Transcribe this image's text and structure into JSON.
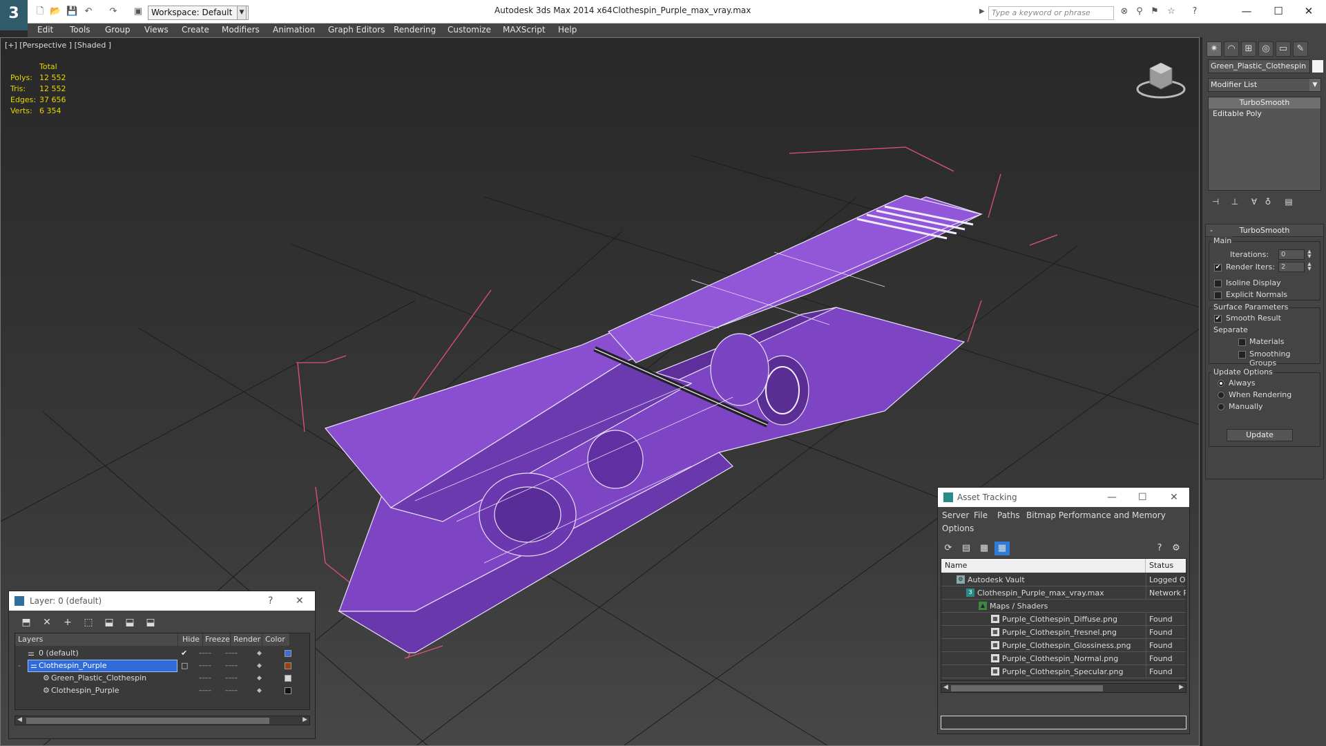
{
  "titlebar": {
    "workspace": "Workspace: Default",
    "app_title": "Autodesk 3ds Max  2014 x64",
    "file_title": "Clothespin_Purple_max_vray.max",
    "search_placeholder": "Type a keyword or phrase"
  },
  "menu": [
    "Edit",
    "Tools",
    "Group",
    "Views",
    "Create",
    "Modifiers",
    "Animation",
    "Graph Editors",
    "Rendering",
    "Customize",
    "MAXScript",
    "Help"
  ],
  "viewport": {
    "label": "[+] [Perspective ] [Shaded ]",
    "stats": {
      "header": "Total",
      "rows": [
        {
          "label": "Polys:",
          "value": "12 552"
        },
        {
          "label": "Tris:",
          "value": "12 552"
        },
        {
          "label": "Edges:",
          "value": "37 656"
        },
        {
          "label": "Verts:",
          "value": "6 354"
        }
      ]
    },
    "model_color": "#8a4fd1"
  },
  "command_panel": {
    "object_name": "Green_Plastic_Clothespin",
    "modifier_list": "Modifier List",
    "stack": [
      "TurboSmooth",
      "Editable Poly"
    ],
    "turbosmooth": {
      "title": "TurboSmooth",
      "main": "Main",
      "iterations_label": "Iterations:",
      "iterations": "0",
      "render_iters_label": "Render Iters:",
      "render_iters": "2",
      "isoline": "Isoline Display",
      "explicit_normals": "Explicit Normals",
      "surface_params": "Surface Parameters",
      "smooth_result": "Smooth Result",
      "separate": "Separate",
      "materials": "Materials",
      "smoothing_groups": "Smoothing Groups",
      "update_options": "Update Options",
      "always": "Always",
      "when_rendering": "When Rendering",
      "manually": "Manually",
      "update_button": "Update"
    }
  },
  "layer_window": {
    "title": "Layer: 0 (default)",
    "help": "?",
    "columns": [
      "Layers",
      "Hide",
      "Freeze",
      "Render",
      "Color"
    ],
    "rows": [
      {
        "name": "0 (default)",
        "color": "#3b6fd6"
      },
      {
        "name": "Clothespin_Purple",
        "color": "#9a3f10"
      },
      {
        "name": "Green_Plastic_Clothespin",
        "color": "#d8d8d8"
      },
      {
        "name": "Clothespin_Purple",
        "color": "#111111"
      }
    ]
  },
  "asset_window": {
    "title": "Asset Tracking",
    "menu": [
      "Server",
      "File",
      "Paths",
      "Bitmap Performance and Memory",
      "Options"
    ],
    "columns": [
      "Name",
      "Status"
    ],
    "rows": [
      {
        "name": "Autodesk Vault",
        "status": "Logged Ou"
      },
      {
        "name": "Clothespin_Purple_max_vray.max",
        "status": "Network Pa"
      },
      {
        "name": "Maps / Shaders",
        "status": ""
      },
      {
        "name": "Purple_Clothespin_Diffuse.png",
        "status": "Found"
      },
      {
        "name": "Purple_Clothespin_fresnel.png",
        "status": "Found"
      },
      {
        "name": "Purple_Clothespin_Glossiness.png",
        "status": "Found"
      },
      {
        "name": "Purple_Clothespin_Normal.png",
        "status": "Found"
      },
      {
        "name": "Purple_Clothespin_Specular.png",
        "status": "Found"
      }
    ]
  }
}
